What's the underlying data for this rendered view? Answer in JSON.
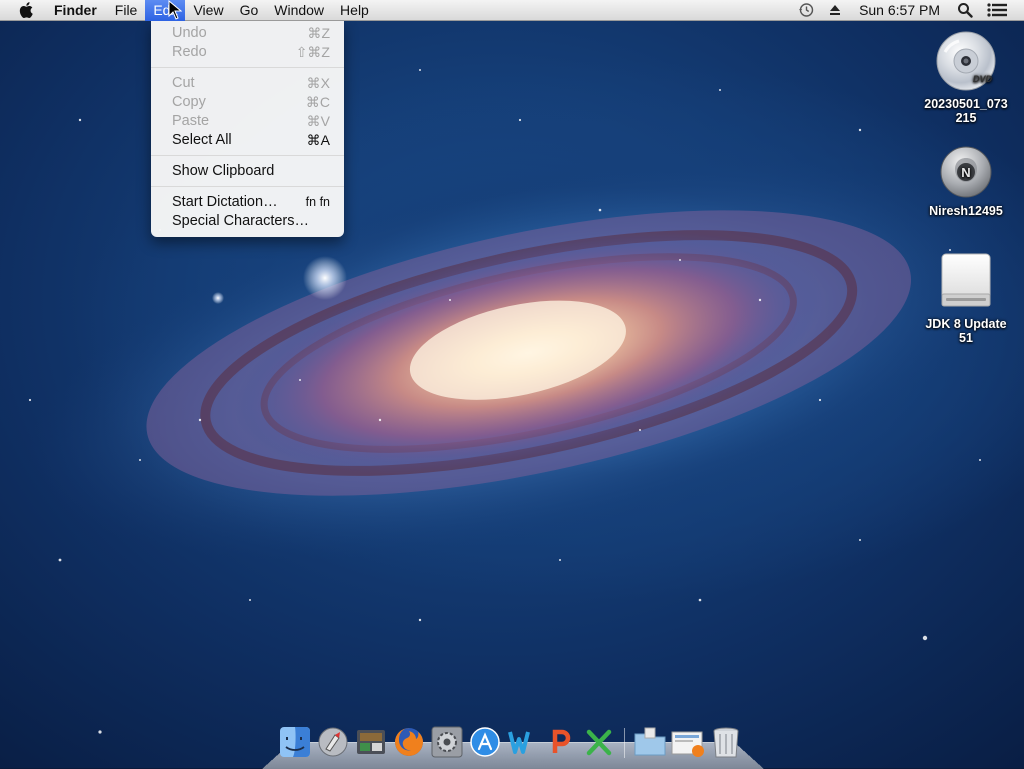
{
  "menubar": {
    "app_name": "Finder",
    "items": [
      "File",
      "Edit",
      "View",
      "Go",
      "Window",
      "Help"
    ],
    "active_item": "Edit",
    "clock": "Sun 6:57 PM",
    "status_icons": [
      "time-machine-icon",
      "eject-icon",
      "spotlight-search-icon",
      "notification-center-icon"
    ]
  },
  "edit_menu": {
    "undo": {
      "label": "Undo",
      "shortcut": "⌘Z"
    },
    "redo": {
      "label": "Redo",
      "shortcut": "⇧⌘Z"
    },
    "cut": {
      "label": "Cut",
      "shortcut": "⌘X"
    },
    "copy": {
      "label": "Copy",
      "shortcut": "⌘C"
    },
    "paste": {
      "label": "Paste",
      "shortcut": "⌘V"
    },
    "select_all": {
      "label": "Select All",
      "shortcut": "⌘A"
    },
    "show_clipboard": {
      "label": "Show Clipboard"
    },
    "start_dictation": {
      "label": "Start Dictation…",
      "shortcut": "fn fn"
    },
    "special_characters": {
      "label": "Special Characters…"
    }
  },
  "desktop_icons": [
    {
      "label": "20230501_073215",
      "icon": "dvd-disc-icon"
    },
    {
      "label": "Niresh12495",
      "icon": "installer-disk-icon"
    },
    {
      "label": "JDK 8 Update 51",
      "icon": "external-drive-icon"
    }
  ],
  "dock": {
    "apps": [
      "finder-icon",
      "launchpad-icon",
      "image-capture-icon",
      "firefox-icon",
      "system-preferences-icon",
      "app-store-icon",
      "word-icon",
      "powerpoint-icon",
      "excel-icon"
    ],
    "stacks": [
      "applications-folder-icon",
      "downloads-stack-icon",
      "trash-icon"
    ]
  },
  "colors": {
    "menu_highlight": "#2d62e3",
    "disabled_text": "#a4a4a4"
  }
}
